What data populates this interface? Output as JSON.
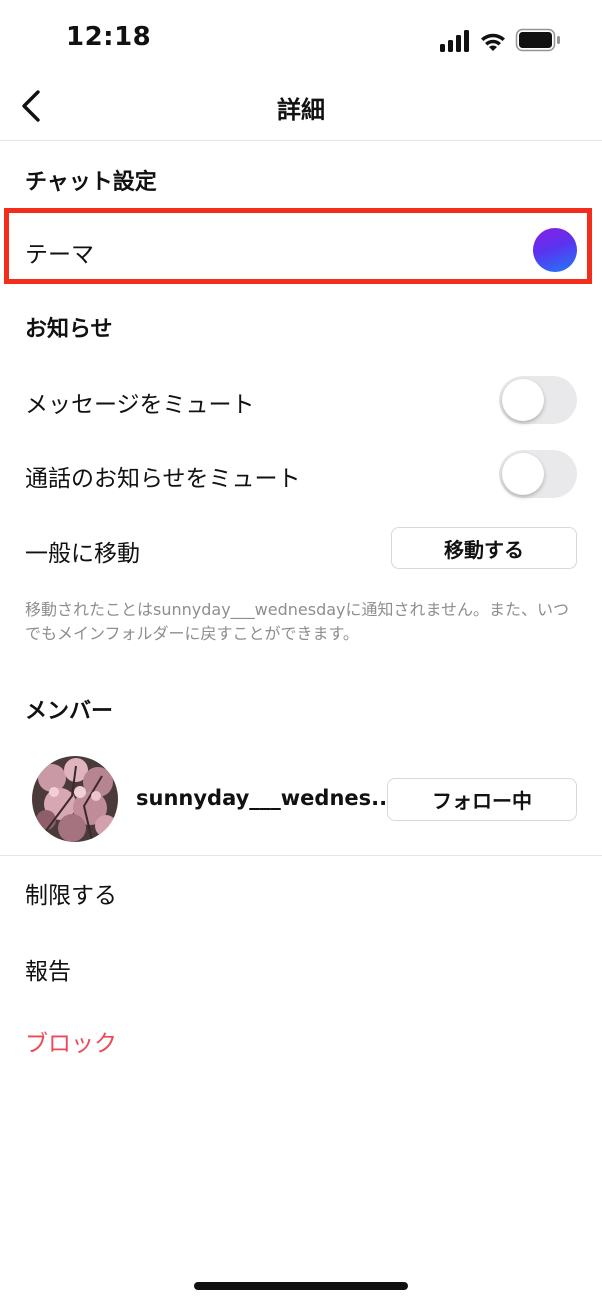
{
  "status_bar": {
    "time": "12:18",
    "icons": [
      "signal-icon",
      "wifi-icon",
      "battery-icon"
    ]
  },
  "nav": {
    "back_icon": "chevron-left-icon",
    "title": "詳細"
  },
  "chat_settings": {
    "header": "チャット設定",
    "theme_label": "テーマ",
    "theme_colors": [
      "#8b1fe0",
      "#1f7bf5"
    ],
    "highlight_color": "#f22d1c"
  },
  "notifications": {
    "header": "お知らせ",
    "mute_messages_label": "メッセージをミュート",
    "mute_messages_on": false,
    "mute_calls_label": "通話のお知らせをミュート",
    "mute_calls_on": false,
    "move_general_label": "一般に移動",
    "move_button_label": "移動する",
    "info_text": "移動されたことはsunnyday___wednesdayに通知されません。また、いつでもメインフォルダーに戻すことができます。"
  },
  "members": {
    "header": "メンバー",
    "list": [
      {
        "username": "sunnyday___wednes...",
        "follow_button_label": "フォロー中"
      }
    ]
  },
  "actions": {
    "restrict_label": "制限する",
    "report_label": "報告",
    "block_label": "ブロック",
    "block_color": "#ed4956"
  }
}
